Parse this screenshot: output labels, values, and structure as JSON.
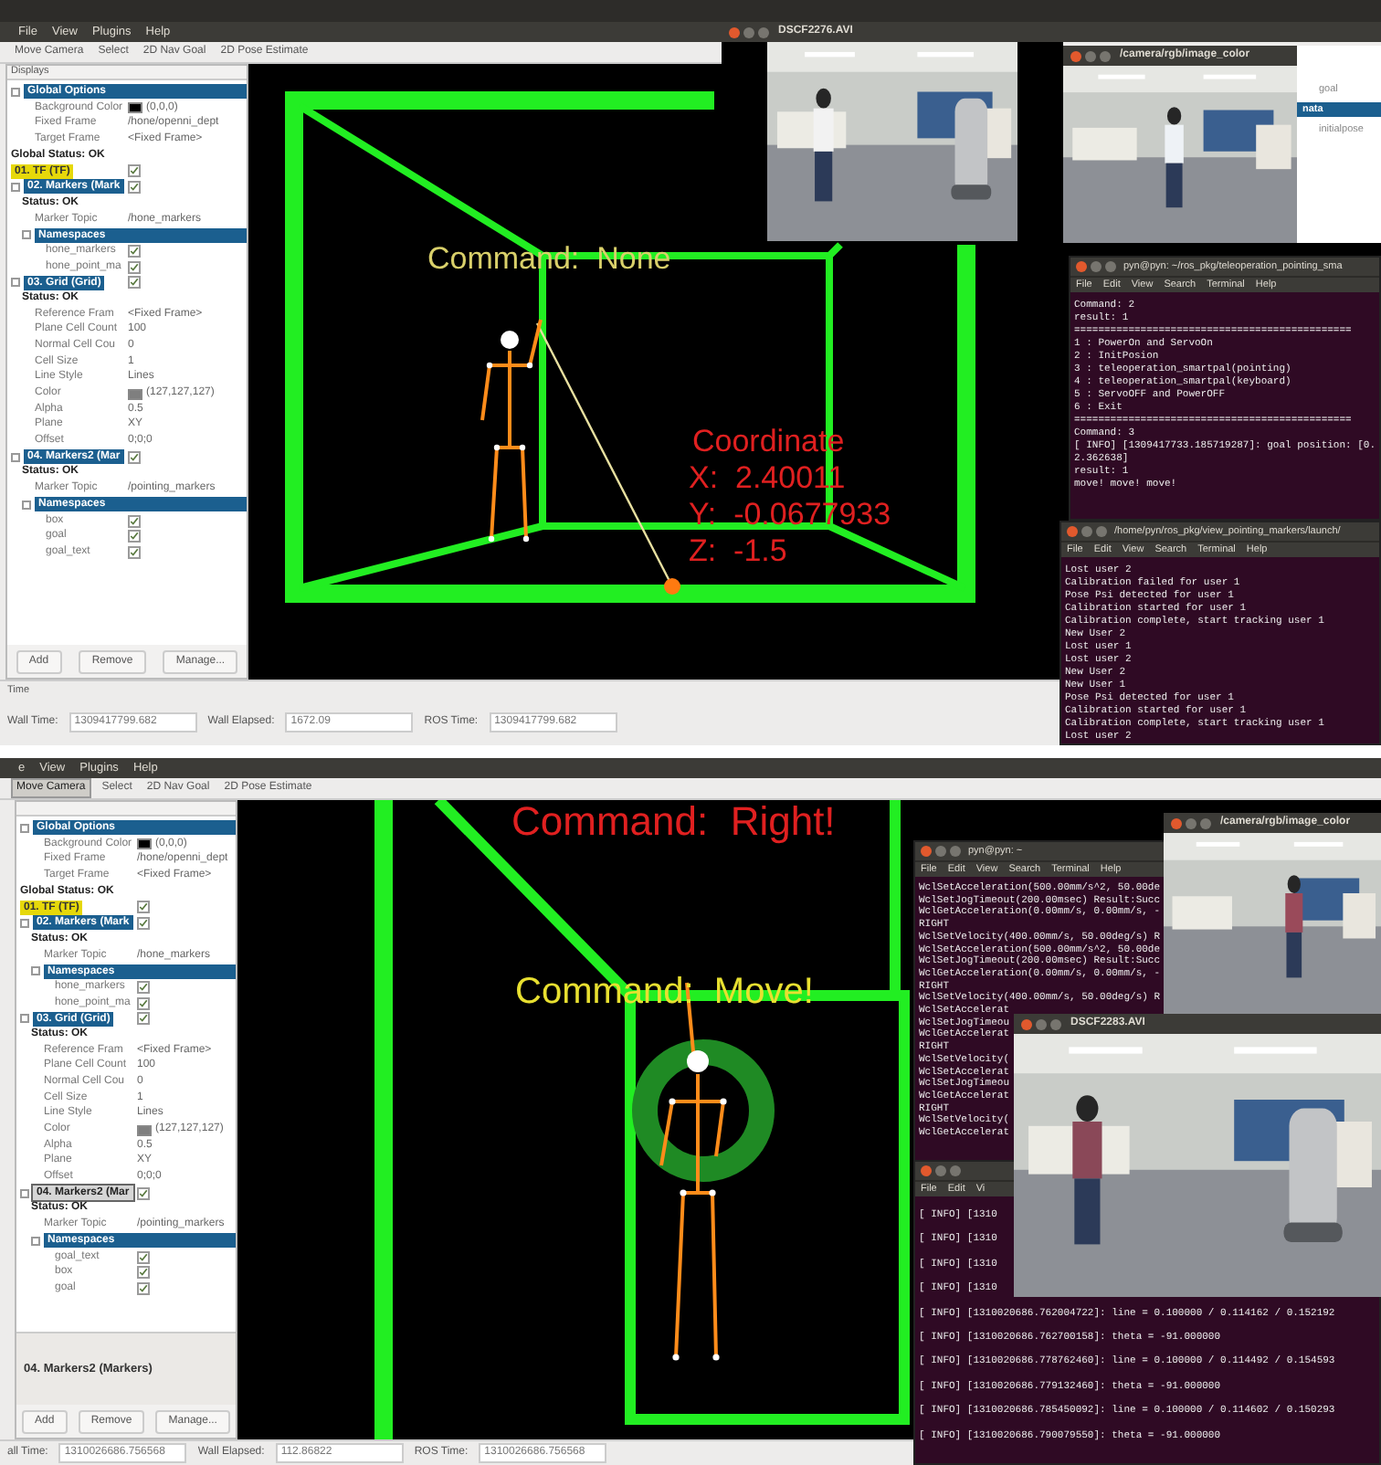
{
  "screens": [
    {
      "rviz": {
        "menu": [
          "File",
          "View",
          "Plugins",
          "Help"
        ],
        "tools": [
          {
            "label": "Move Camera",
            "selected": false
          },
          {
            "label": "Select",
            "selected": false
          },
          {
            "label": "2D Nav Goal",
            "selected": false
          },
          {
            "label": "2D Pose Estimate",
            "selected": false
          }
        ],
        "displays_title": "Displays",
        "displays": [
          {
            "kind": "group",
            "label": "Global Options",
            "children": [
              {
                "kind": "color",
                "label": "Background Color",
                "value": "(0,0,0)"
              },
              {
                "kind": "property",
                "label": "Fixed Frame",
                "value": "/hone/openni_dept"
              },
              {
                "kind": "property",
                "label": "Target Frame",
                "value": "<Fixed Frame>"
              }
            ]
          },
          {
            "kind": "status",
            "label": "Global Status: OK"
          },
          {
            "kind": "display",
            "label": "01. TF (TF)",
            "warning": true,
            "selected": false,
            "checked": true
          },
          {
            "kind": "display",
            "label": "02. Markers (Mark",
            "warning": false,
            "selected": false,
            "checked": true,
            "children": [
              {
                "kind": "status",
                "label": "Status: OK"
              },
              {
                "kind": "property",
                "label": "Marker Topic",
                "value": "/hone_markers"
              },
              {
                "kind": "group",
                "label": "Namespaces",
                "children": [
                  {
                    "kind": "check",
                    "label": "hone_markers",
                    "checked": true
                  },
                  {
                    "kind": "check",
                    "label": "hone_point_ma",
                    "checked": true
                  }
                ]
              }
            ]
          },
          {
            "kind": "display",
            "label": "03. Grid (Grid)",
            "warning": false,
            "selected": false,
            "checked": true,
            "children": [
              {
                "kind": "status",
                "label": "Status: OK"
              },
              {
                "kind": "property",
                "label": "Reference Fram",
                "value": "<Fixed Frame>"
              },
              {
                "kind": "property",
                "label": "Plane Cell Count",
                "value": "100"
              },
              {
                "kind": "property",
                "label": "Normal Cell Cou",
                "value": "0"
              },
              {
                "kind": "property",
                "label": "Cell Size",
                "value": "1"
              },
              {
                "kind": "property",
                "label": "Line Style",
                "value": "Lines"
              },
              {
                "kind": "color",
                "label": "Color",
                "value": "(127,127,127)"
              },
              {
                "kind": "property",
                "label": "Alpha",
                "value": "0.5"
              },
              {
                "kind": "property",
                "label": "Plane",
                "value": "XY"
              },
              {
                "kind": "property",
                "label": "Offset",
                "value": "0;0;0"
              }
            ]
          },
          {
            "kind": "display",
            "label": "04. Markers2 (Mar",
            "warning": false,
            "selected": false,
            "checked": true,
            "children": [
              {
                "kind": "status",
                "label": "Status: OK"
              },
              {
                "kind": "property",
                "label": "Marker Topic",
                "value": "/pointing_markers"
              },
              {
                "kind": "group",
                "label": "Namespaces",
                "children": [
                  {
                    "kind": "check",
                    "label": "box",
                    "checked": true
                  },
                  {
                    "kind": "check",
                    "label": "goal",
                    "checked": true
                  },
                  {
                    "kind": "check",
                    "label": "goal_text",
                    "checked": true
                  }
                ]
              }
            ]
          }
        ],
        "buttons": [
          "Add",
          "Remove",
          "Manage..."
        ],
        "time_title": "Time",
        "time_fields": [
          {
            "label": "Wall Time:",
            "value": "1309417799.682"
          },
          {
            "label": "Wall Elapsed:",
            "value": "1672.09"
          },
          {
            "label": "ROS Time:",
            "value": "1309417799.682"
          }
        ]
      },
      "view": {
        "labels": [
          {
            "text": "Command:  None",
            "color": "#d9d06a"
          },
          {
            "text": "Coordinate",
            "color": "#e02020"
          },
          {
            "text": "X:  2.40011",
            "color": "#e02020"
          },
          {
            "text": "Y:  -0.0677933",
            "color": "#e02020"
          },
          {
            "text": "Z:  -1.5",
            "color": "#e02020"
          }
        ]
      },
      "windows": [
        {
          "kind": "video",
          "title": "DSCF2276.AVI"
        },
        {
          "kind": "video",
          "title": "/camera/rgb/image_color"
        },
        {
          "kind": "panel",
          "rows": [
            {
              "label": "goal",
              "selected": false
            },
            {
              "label": "nata",
              "selected": true
            },
            {
              "label": "initialpose",
              "selected": false
            }
          ]
        },
        {
          "kind": "terminal",
          "title": "pyn@pyn: ~/ros_pkg/teleoperation_pointing_sma",
          "menu": [
            "File",
            "Edit",
            "View",
            "Search",
            "Terminal",
            "Help"
          ],
          "lines": [
            "Command: 2",
            "result: 1",
            "==============================================",
            "1 : PowerOn and ServoOn",
            "2 : InitPosion",
            "3 : teleoperation_smartpal(pointing)",
            "4 : teleoperation_smartpal(keyboard)",
            "5 : ServoOFF and PowerOFF",
            "6 : Exit",
            "==============================================",
            "Command: 3",
            "[ INFO] [1309417733.185719287]: goal position: [0.",
            "2.362638]",
            "result: 1",
            "move! move! move!"
          ]
        },
        {
          "kind": "terminal",
          "title": "/home/pyn/ros_pkg/view_pointing_markers/launch/",
          "menu": [
            "File",
            "Edit",
            "View",
            "Search",
            "Terminal",
            "Help"
          ],
          "lines": [
            "Lost user 2",
            "Calibration failed for user 1",
            "Pose Psi detected for user 1",
            "Calibration started for user 1",
            "Calibration complete, start tracking user 1",
            "New User 2",
            "Lost user 1",
            "Lost user 2",
            "New User 2",
            "New User 1",
            "Pose Psi detected for user 1",
            "Calibration started for user 1",
            "Calibration complete, start tracking user 1",
            "Lost user 2"
          ]
        }
      ]
    },
    {
      "rviz": {
        "menu": [
          "e",
          "View",
          "Plugins",
          "Help"
        ],
        "tools": [
          {
            "label": "Move Camera",
            "selected": true
          },
          {
            "label": "Select",
            "selected": false
          },
          {
            "label": "2D Nav Goal",
            "selected": false
          },
          {
            "label": "2D Pose Estimate",
            "selected": false
          }
        ],
        "displays": [
          {
            "kind": "group",
            "label": "Global Options",
            "children": [
              {
                "kind": "color",
                "label": "Background Color",
                "value": "(0,0,0)"
              },
              {
                "kind": "property",
                "label": "Fixed Frame",
                "value": "/hone/openni_dept"
              },
              {
                "kind": "property",
                "label": "Target Frame",
                "value": "<Fixed Frame>"
              }
            ]
          },
          {
            "kind": "status",
            "label": "Global Status: OK"
          },
          {
            "kind": "display",
            "label": "01. TF (TF)",
            "warning": true,
            "selected": false,
            "checked": true
          },
          {
            "kind": "display",
            "label": "02. Markers (Mark",
            "warning": false,
            "selected": false,
            "checked": true,
            "children": [
              {
                "kind": "status",
                "label": "Status: OK"
              },
              {
                "kind": "property",
                "label": "Marker Topic",
                "value": "/hone_markers"
              },
              {
                "kind": "group",
                "label": "Namespaces",
                "children": [
                  {
                    "kind": "check",
                    "label": "hone_markers",
                    "checked": true
                  },
                  {
                    "kind": "check",
                    "label": "hone_point_ma",
                    "checked": true
                  }
                ]
              }
            ]
          },
          {
            "kind": "display",
            "label": "03. Grid (Grid)",
            "warning": false,
            "selected": false,
            "checked": true,
            "children": [
              {
                "kind": "status",
                "label": "Status: OK"
              },
              {
                "kind": "property",
                "label": "Reference Fram",
                "value": "<Fixed Frame>"
              },
              {
                "kind": "property",
                "label": "Plane Cell Count",
                "value": "100"
              },
              {
                "kind": "property",
                "label": "Normal Cell Cou",
                "value": "0"
              },
              {
                "kind": "property",
                "label": "Cell Size",
                "value": "1"
              },
              {
                "kind": "property",
                "label": "Line Style",
                "value": "Lines"
              },
              {
                "kind": "color",
                "label": "Color",
                "value": "(127,127,127)"
              },
              {
                "kind": "property",
                "label": "Alpha",
                "value": "0.5"
              },
              {
                "kind": "property",
                "label": "Plane",
                "value": "XY"
              },
              {
                "kind": "property",
                "label": "Offset",
                "value": "0;0;0"
              }
            ]
          },
          {
            "kind": "display",
            "label": "04. Markers2 (Mar",
            "warning": false,
            "selected": true,
            "checked": true,
            "children": [
              {
                "kind": "status",
                "label": "Status: OK"
              },
              {
                "kind": "property",
                "label": "Marker Topic",
                "value": "/pointing_markers"
              },
              {
                "kind": "group",
                "label": "Namespaces",
                "children": [
                  {
                    "kind": "check",
                    "label": "goal_text",
                    "checked": true
                  },
                  {
                    "kind": "check",
                    "label": "box",
                    "checked": true
                  },
                  {
                    "kind": "check",
                    "label": "goal",
                    "checked": true
                  }
                ]
              }
            ]
          }
        ],
        "selection_title": "04. Markers2 (Markers)",
        "buttons": [
          "Add",
          "Remove",
          "Manage..."
        ],
        "time_fields": [
          {
            "label": "all Time:",
            "value": "1310026686.756568"
          },
          {
            "label": "Wall Elapsed:",
            "value": "112.86822"
          },
          {
            "label": "ROS Time:",
            "value": "1310026686.756568"
          }
        ]
      },
      "view": {
        "labels": [
          {
            "text": "Command:  Right!",
            "color": "#e02020"
          },
          {
            "text": "Command:  Move!",
            "color": "#e8e030"
          }
        ]
      },
      "windows": [
        {
          "kind": "terminal",
          "title": "pyn@pyn: ~",
          "menu": [
            "File",
            "Edit",
            "View",
            "Search",
            "Terminal",
            "Help"
          ],
          "lines": [
            "WclSetAcceleration(500.00mm/s^2, 50.00de",
            "WclSetJogTimeout(200.00msec) Result:Succ",
            "WclGetAcceleration(0.00mm/s, 0.00mm/s, -",
            "RIGHT",
            "WclSetVelocity(400.00mm/s, 50.00deg/s) R",
            "WclSetAcceleration(500.00mm/s^2, 50.00de",
            "WclSetJogTimeout(200.00msec) Result:Succ",
            "WclGetAcceleration(0.00mm/s, 0.00mm/s, -",
            "RIGHT",
            "WclSetVelocity(400.00mm/s, 50.00deg/s) R",
            "WclSetAccelerat",
            "WclSetJogTimeou",
            "WclGetAccelerat",
            "RIGHT",
            "WclSetVelocity(",
            "WclSetAccelerat",
            "WclSetJogTimeou",
            "WclGetAccelerat",
            "RIGHT",
            "WclSetVelocity(",
            "WclGetAccelerat"
          ]
        },
        {
          "kind": "video",
          "title": "/camera/rgb/image_color"
        },
        {
          "kind": "video",
          "title": "DSCF2283.AVI"
        },
        {
          "kind": "terminal",
          "menu": [
            "File",
            "Edit",
            "Vi"
          ],
          "lines": [
            "[ INFO] [1310",
            "[ INFO] [1310",
            "[ INFO] [1310",
            "[ INFO] [1310",
            "[ INFO] [1310020686.762004722]: line = 0.100000 / 0.114162 / 0.152192",
            "[ INFO] [1310020686.762700158]: theta = -91.000000",
            "[ INFO] [1310020686.778762460]: line = 0.100000 / 0.114492 / 0.154593",
            "[ INFO] [1310020686.779132460]: theta = -91.000000",
            "[ INFO] [1310020686.785450092]: line = 0.100000 / 0.114602 / 0.150293",
            "[ INFO] [1310020686.790079550]: theta = -91.000000"
          ]
        }
      ]
    }
  ]
}
